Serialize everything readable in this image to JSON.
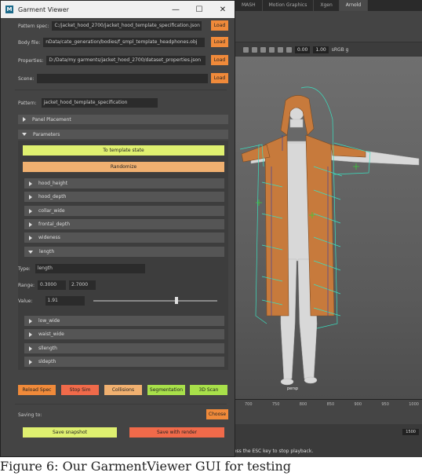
{
  "window": {
    "title": "Garment Viewer",
    "minimize": "—",
    "maximize": "☐",
    "close": "✕",
    "logo": "M"
  },
  "files": {
    "pattern_spec": {
      "label": "Pattern spec:",
      "value": "C:/jacket_hood_2700/jacket_hood_template_specification.json",
      "button": "Load"
    },
    "body_file": {
      "label": "Body file:",
      "value": "nData/cate_generation/bodies/f_smpl_template_headphones.obj",
      "button": "Load"
    },
    "properties": {
      "label": "Properties:",
      "value": "D:/Data/my garments/jacket_hood_2700/dataset_properties.json",
      "button": "Load"
    },
    "scene": {
      "label": "Scene:",
      "value": "",
      "button": "Load"
    }
  },
  "pattern": {
    "label": "Pattern:",
    "value": "jacket_hood_template_specification"
  },
  "sections": {
    "panel_placement": "Panel Placement",
    "parameters": "Parameters"
  },
  "buttons": {
    "to_template": "To template state",
    "randomize": "Randomize"
  },
  "params_top": [
    "hood_height",
    "hood_depth",
    "collar_wide",
    "frontal_depth",
    "wideness"
  ],
  "param_open": {
    "name": "length",
    "type_label": "Type:",
    "type_value": "length",
    "range_label": "Range:",
    "range_min": "0.3000",
    "range_max": "2.7000",
    "value_label": "Value:",
    "value": "1.91",
    "slider_fraction": 0.67
  },
  "params_bottom": [
    "low_wide",
    "waist_wide",
    "sllength",
    "sldepth"
  ],
  "actions": [
    "Reload Spec",
    "Stop Sim",
    "Collisions",
    "Segmentation",
    "3D Scan"
  ],
  "saving": {
    "label": "Saving to:",
    "choose": "Choose",
    "save_snapshot": "Save snapshot",
    "save_render": "Save with render"
  },
  "maya": {
    "tabs": [
      "MASH",
      "Motion Graphics",
      "Xgen",
      "Arnold"
    ],
    "field1": "0.00",
    "field2": "1.00",
    "color_space": "sRGB g",
    "persp": "persp",
    "frames": [
      "700",
      "750",
      "800",
      "850",
      "900",
      "950",
      "1000"
    ],
    "range_end": "1500",
    "status": "Press the ESC key to stop playback."
  },
  "colors": {
    "load": "#f08a3a",
    "to_template": "#dff070",
    "randomize": "#f0b070",
    "reload": "#f08a3a",
    "stop": "#f06a4a",
    "collisions": "#f0b070",
    "segmentation": "#a8e04a",
    "scan": "#a8e04a",
    "garment": "#c77a3c",
    "wire": "#3ae0c0"
  },
  "caption": "Figure 6:  Our GarmentViewer GUI for testing"
}
